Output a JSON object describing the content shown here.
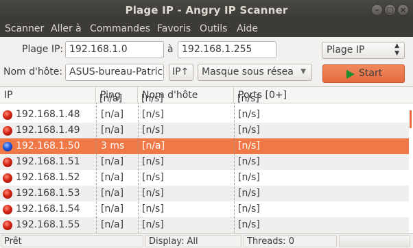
{
  "window": {
    "title": "Plage IP - Angry IP Scanner",
    "controls": [
      "minimize",
      "maximize",
      "close"
    ]
  },
  "menu": [
    "Scanner",
    "Aller à",
    "Commandes",
    "Favoris",
    "Outils",
    "Aide"
  ],
  "form": {
    "ip_range_label": "Plage IP:",
    "ip_from": "192.168.1.0",
    "to_label": "à",
    "ip_to": "192.168.1.255",
    "mode_select": "Plage IP",
    "hostname_label": "Nom d'hôte:",
    "hostname": "ASUS-bureau-Patrice",
    "ip_button": "IP↑",
    "mask_select": "Masque sous réseau",
    "start_button": "Start"
  },
  "table": {
    "columns": [
      "IP",
      "Ping",
      "Nom d'hôte",
      "Ports [0+]"
    ],
    "partial_row": {
      "ip": "",
      "ping": "[n/a]",
      "hostname": "[n/s]",
      "ports": "[n/s]"
    },
    "rows": [
      {
        "ip": "192.168.1.48",
        "ping": "[n/a]",
        "hostname": "[n/s]",
        "ports": "[n/s]",
        "status": "dead"
      },
      {
        "ip": "192.168.1.49",
        "ping": "[n/a]",
        "hostname": "[n/s]",
        "ports": "[n/s]",
        "status": "dead"
      },
      {
        "ip": "192.168.1.50",
        "ping": "3 ms",
        "hostname": "[n/a]",
        "ports": "[n/s]",
        "status": "alive",
        "selected": true
      },
      {
        "ip": "192.168.1.51",
        "ping": "[n/a]",
        "hostname": "[n/s]",
        "ports": "[n/s]",
        "status": "dead"
      },
      {
        "ip": "192.168.1.52",
        "ping": "[n/a]",
        "hostname": "[n/s]",
        "ports": "[n/s]",
        "status": "dead"
      },
      {
        "ip": "192.168.1.53",
        "ping": "[n/a]",
        "hostname": "[n/s]",
        "ports": "[n/s]",
        "status": "dead"
      },
      {
        "ip": "192.168.1.54",
        "ping": "[n/a]",
        "hostname": "[n/s]",
        "ports": "[n/s]",
        "status": "dead"
      },
      {
        "ip": "192.168.1.55",
        "ping": "[n/a]",
        "hostname": "[n/s]",
        "ports": "[n/s]",
        "status": "dead"
      }
    ]
  },
  "status": {
    "state": "Prêt",
    "display": "Display: All",
    "threads": "Threads: 0"
  },
  "colors": {
    "accent": "#f07746",
    "titlebar": "#3c3b37",
    "dead": "#d32414",
    "alive": "#1e56d6"
  }
}
